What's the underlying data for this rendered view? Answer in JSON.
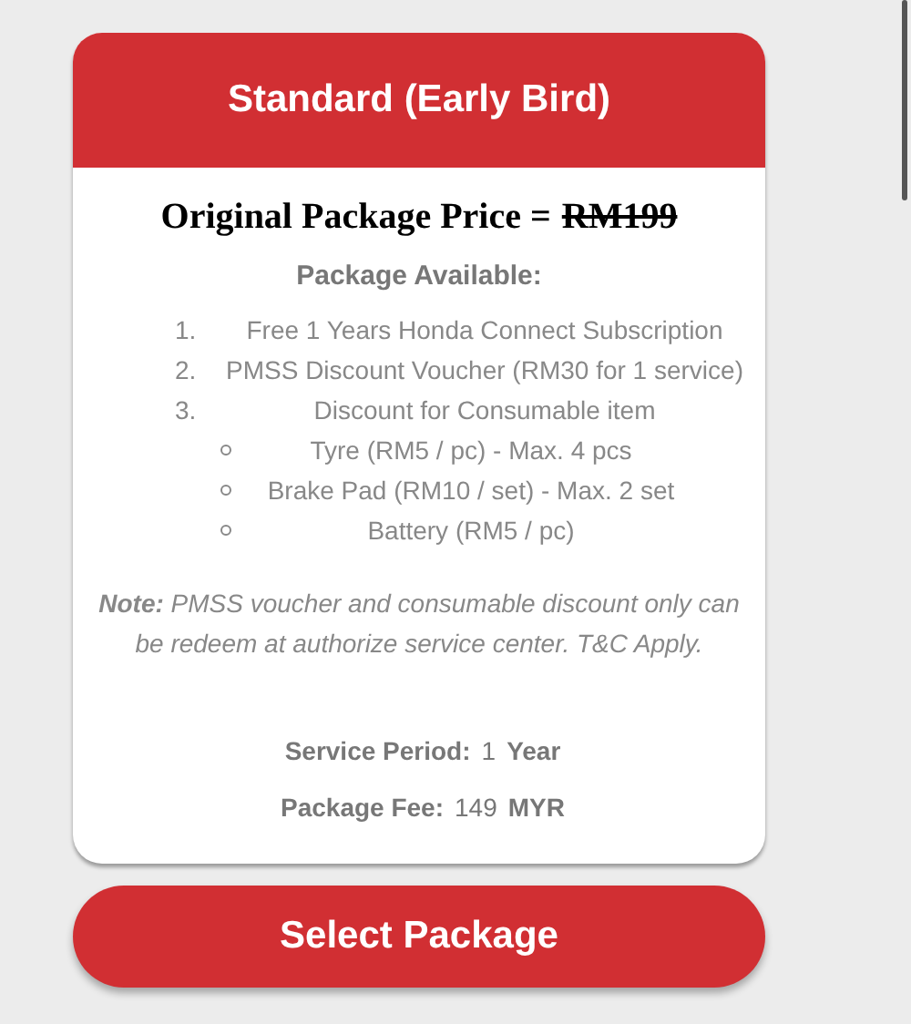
{
  "card": {
    "title": "Standard (Early Bird)",
    "price_label": "Original Package Price =",
    "price_struck": "RM199",
    "list_heading": "Package Available:",
    "items": [
      {
        "marker": "1.",
        "text": "Free 1 Years Honda Connect Subscription"
      },
      {
        "marker": "2.",
        "text": "PMSS Discount Voucher (RM30 for 1 service)"
      },
      {
        "marker": "3.",
        "text": "Discount for Consumable item",
        "children": [
          {
            "text": "Tyre (RM5 / pc) - Max. 4 pcs"
          },
          {
            "text": "Brake Pad (RM10 / set) - Max. 2 set"
          },
          {
            "text": "Battery (RM5 / pc)"
          }
        ]
      }
    ],
    "note": "**Note:** PMSS voucher and consumable discount only can be redeem at authorize service center. T&C Apply.",
    "details": [
      {
        "label": "Service Period:",
        "value": "1",
        "unit": "Year"
      },
      {
        "label": "Package Fee:",
        "value": "149",
        "unit": "MYR"
      }
    ]
  },
  "button": "Select Package"
}
